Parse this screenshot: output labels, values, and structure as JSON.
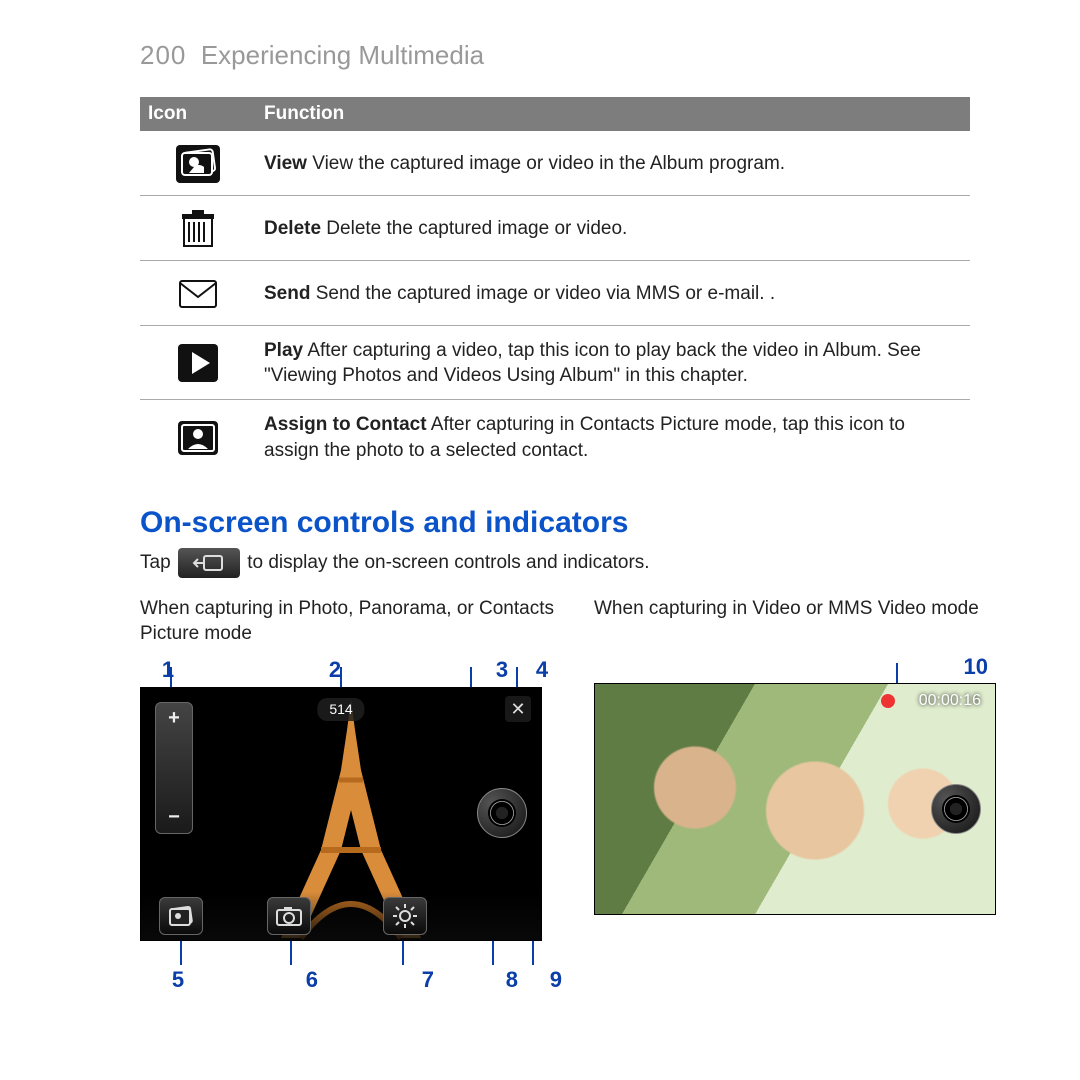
{
  "page": {
    "number": "200",
    "title": "Experiencing Multimedia"
  },
  "table": {
    "headers": {
      "icon": "Icon",
      "function": "Function"
    },
    "rows": [
      {
        "bold": "View",
        "text": "  View the captured image or video in the Album program."
      },
      {
        "bold": "Delete",
        "text": "  Delete the captured image or video."
      },
      {
        "bold": "Send",
        "text": "  Send the captured image or video via MMS or e-mail. ."
      },
      {
        "bold": "Play",
        "text": "  After capturing a video, tap this icon to play back the video in Album. See \"Viewing Photos and Videos Using Album\" in this chapter."
      },
      {
        "bold": "Assign to Contact",
        "text": "  After capturing in Contacts Picture mode, tap this icon to assign the photo to a selected contact."
      }
    ]
  },
  "section_title": "On-screen controls and indicators",
  "tap_line": {
    "before": "Tap ",
    "after": " to display the on-screen controls and indicators."
  },
  "photo": {
    "caption": "When capturing in Photo, Panorama, or Contacts Picture mode",
    "counter": "514",
    "labels_top": [
      "1",
      "2",
      "3",
      "4"
    ],
    "labels_bottom": [
      "5",
      "6",
      "7",
      "8",
      "9"
    ]
  },
  "video": {
    "caption": "When capturing in Video or MMS Video mode",
    "timer": "00:00:16",
    "label": "10"
  }
}
